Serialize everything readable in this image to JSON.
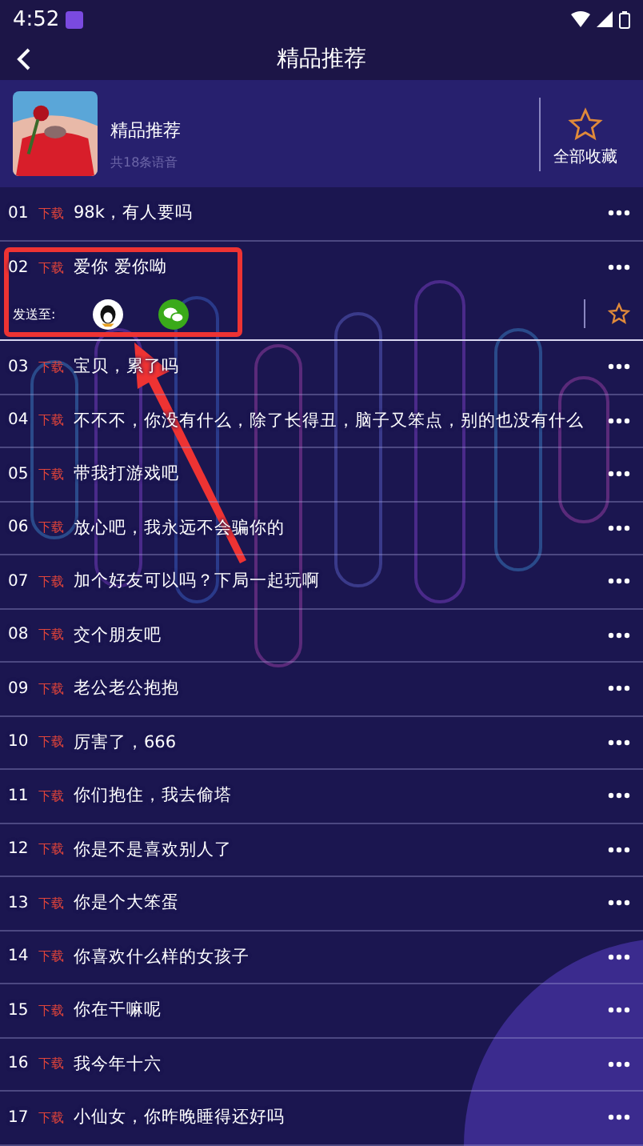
{
  "status_bar": {
    "time": "4:52"
  },
  "top_bar": {
    "title": "精品推荐"
  },
  "album": {
    "kind": "picture",
    "name": "精品推荐",
    "count": "共18条语音",
    "favorite_label": "全部收藏"
  },
  "tracks": [
    {
      "number": "01",
      "download": "下载",
      "text": "98k，有人要吗",
      "expanded": false
    },
    {
      "number": "02",
      "download": "下载",
      "text": "爱你 爱你呦",
      "expanded": true,
      "share_label": "发送至:",
      "favorited": false
    },
    {
      "number": "03",
      "download": "下载",
      "text": "宝贝，累了吗",
      "expanded": false
    },
    {
      "number": "04",
      "download": "下载",
      "text": "不不不，你没有什么，除了长得丑，脑子又笨点，别的也没有什么",
      "expanded": false
    },
    {
      "number": "05",
      "download": "下载",
      "text": "带我打游戏吧",
      "expanded": false
    },
    {
      "number": "06",
      "download": "下载",
      "text": "放心吧，我永远不会骗你的",
      "expanded": false
    },
    {
      "number": "07",
      "download": "下载",
      "text": "加个好友可以吗？下局一起玩啊",
      "expanded": false
    },
    {
      "number": "08",
      "download": "下载",
      "text": "交个朋友吧",
      "expanded": false
    },
    {
      "number": "09",
      "download": "下载",
      "text": "老公老公抱抱",
      "expanded": false
    },
    {
      "number": "10",
      "download": "下载",
      "text": "厉害了，666",
      "expanded": false
    },
    {
      "number": "11",
      "download": "下载",
      "text": "你们抱住，我去偷塔",
      "expanded": false
    },
    {
      "number": "12",
      "download": "下载",
      "text": "你是不是喜欢别人了",
      "expanded": false
    },
    {
      "number": "13",
      "download": "下载",
      "text": "你是个大笨蛋",
      "expanded": false
    },
    {
      "number": "14",
      "download": "下载",
      "text": "你喜欢什么样的女孩子",
      "expanded": false
    },
    {
      "number": "15",
      "download": "下载",
      "text": "你在干嘛呢",
      "expanded": false
    },
    {
      "number": "16",
      "download": "下载",
      "text": "我今年十六",
      "expanded": false
    },
    {
      "number": "17",
      "download": "下载",
      "text": "小仙女，你昨晚睡得还好吗",
      "expanded": false
    }
  ]
}
